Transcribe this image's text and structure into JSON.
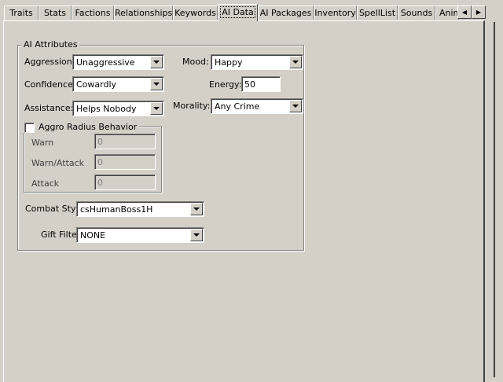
{
  "tabs": [
    {
      "label": "Traits"
    },
    {
      "label": "Stats"
    },
    {
      "label": "Factions"
    },
    {
      "label": "Relationships"
    },
    {
      "label": "Keywords"
    },
    {
      "label": "AI Data",
      "active": true
    },
    {
      "label": "AI Packages"
    },
    {
      "label": "Inventory"
    },
    {
      "label": "SpellList"
    },
    {
      "label": "Sounds"
    },
    {
      "label": "Anim"
    }
  ],
  "tab_scroll": {
    "left_icon": "arrow-left-icon",
    "right_icon": "arrow-right-icon"
  },
  "ai_attributes": {
    "title": "AI Attributes",
    "aggression": {
      "label": "Aggression:",
      "value": "Unaggressive"
    },
    "confidence": {
      "label": "Confidence:",
      "value": "Cowardly"
    },
    "assistance": {
      "label": "Assistance:",
      "value": "Helps Nobody"
    },
    "mood": {
      "label": "Mood:",
      "value": "Happy"
    },
    "energy": {
      "label": "Energy:",
      "value": "50"
    },
    "morality": {
      "label": "Morality:",
      "value": "Any Crime"
    },
    "aggro_radius": {
      "label": "Aggro Radius Behavior",
      "checked": false,
      "warn": {
        "label": "Warn",
        "value": "0"
      },
      "warn_attack": {
        "label": "Warn/Attack",
        "value": "0"
      },
      "attack": {
        "label": "Attack",
        "value": "0"
      }
    },
    "combat_style": {
      "label": "Combat Style",
      "value": "csHumanBoss1H"
    },
    "gift_filter": {
      "label": "Gift Filter",
      "value": "NONE"
    }
  }
}
